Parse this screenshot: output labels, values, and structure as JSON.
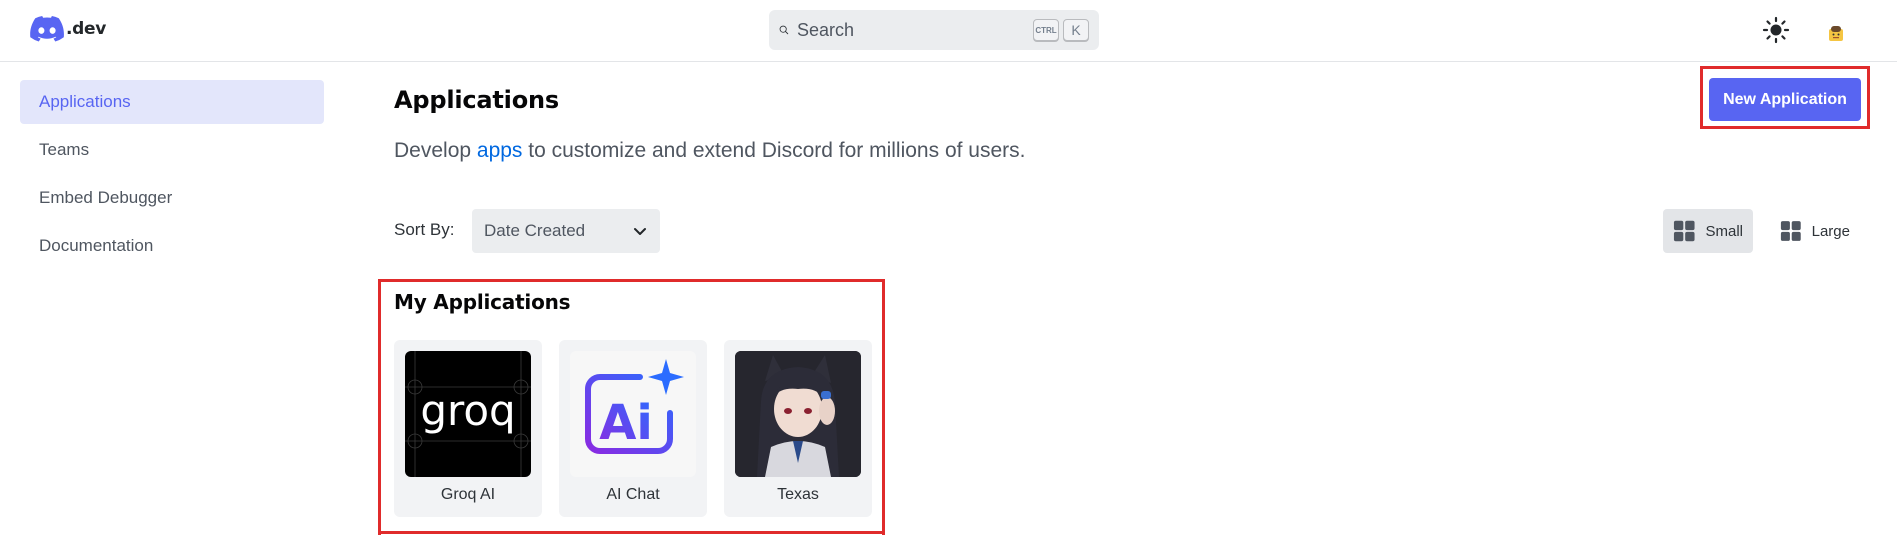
{
  "header": {
    "logo_text": ".dev",
    "search_placeholder": "Search",
    "shortcut_ctrl": "CTRL",
    "shortcut_k": "K"
  },
  "sidebar": {
    "items": [
      {
        "label": "Applications",
        "active": true
      },
      {
        "label": "Teams"
      },
      {
        "label": "Embed Debugger"
      },
      {
        "label": "Documentation"
      }
    ]
  },
  "main": {
    "title": "Applications",
    "subtitle_before": "Develop ",
    "subtitle_link": "apps",
    "subtitle_after": " to customize and extend Discord for millions of users.",
    "new_app_label": "New Application",
    "sort_label": "Sort By:",
    "sort_value": "Date Created",
    "view_small_label": "Small",
    "view_large_label": "Large",
    "section_title": "My Applications",
    "apps": [
      {
        "name": "Groq AI",
        "icon_text": "groq"
      },
      {
        "name": "AI Chat",
        "icon_text": "Ai"
      },
      {
        "name": "Texas"
      }
    ]
  },
  "colors": {
    "brand": "#5865f2",
    "highlight_box": "#e02b2b",
    "link": "#0068e0",
    "active_bg": "#e3e6fb"
  },
  "icons": [
    "discord-logo-icon",
    "search-icon",
    "sun-icon",
    "chevron-down-icon",
    "grid-small-icon",
    "grid-large-icon"
  ]
}
